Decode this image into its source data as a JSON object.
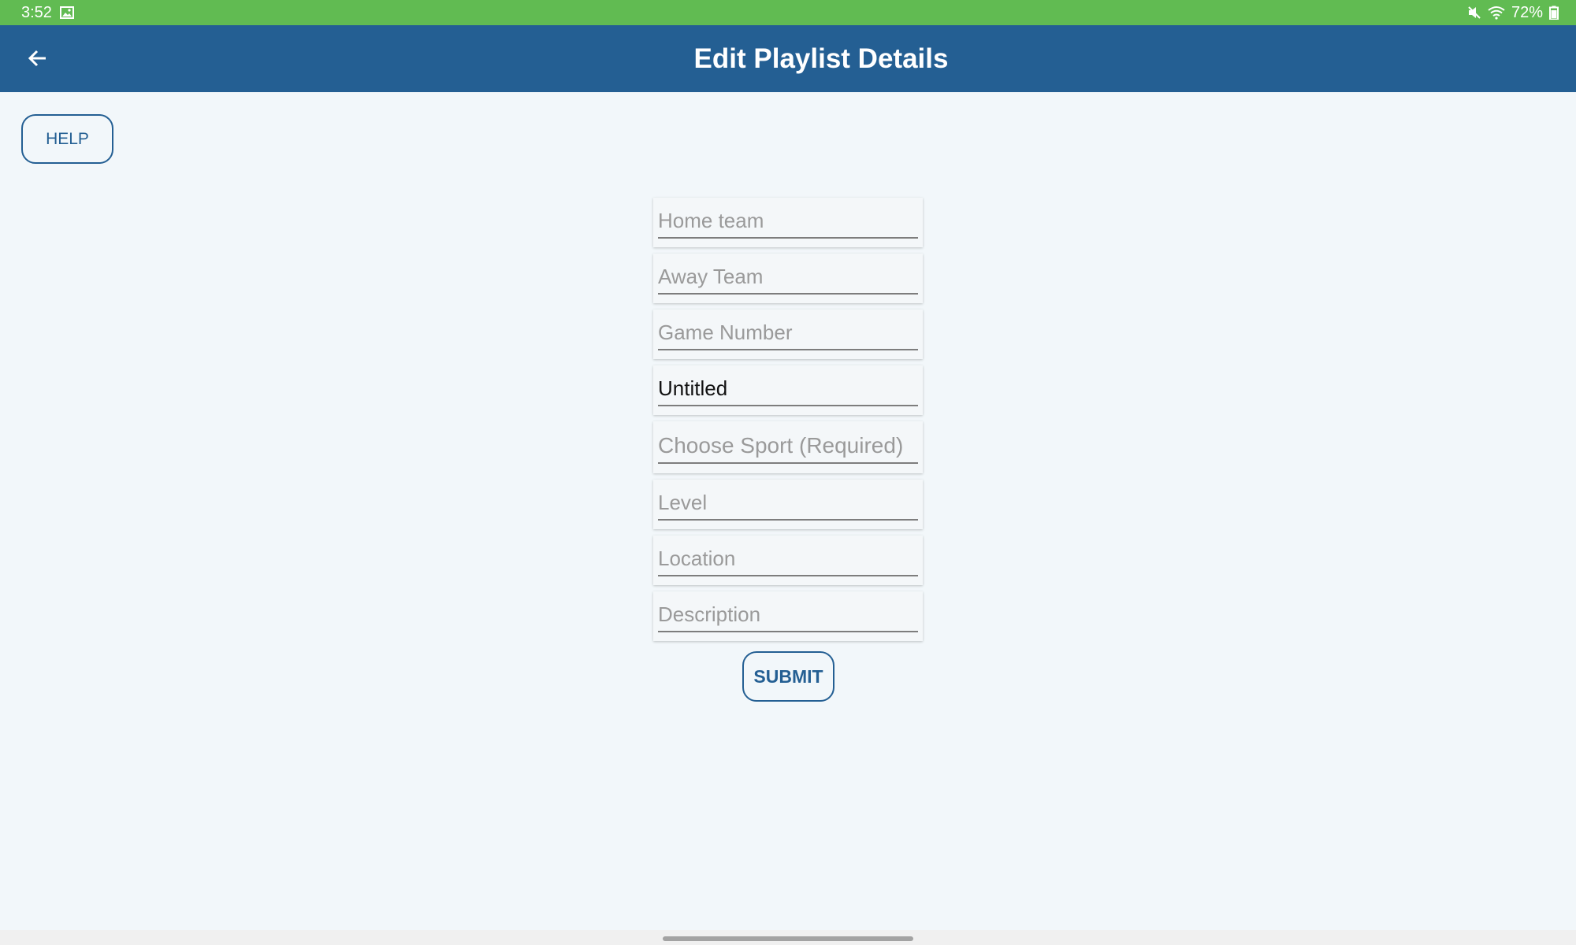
{
  "status_bar": {
    "time": "3:52",
    "battery": "72%",
    "icons": [
      "image-icon",
      "mute-icon",
      "wifi-icon",
      "battery-icon"
    ]
  },
  "app_bar": {
    "title": "Edit Playlist Details",
    "back_icon": "arrow-left-icon"
  },
  "help_button": {
    "label": "HELP"
  },
  "form": {
    "fields": [
      {
        "name": "home-team-input",
        "placeholder": "Home team",
        "value": ""
      },
      {
        "name": "away-team-input",
        "placeholder": "Away Team",
        "value": ""
      },
      {
        "name": "game-number-input",
        "placeholder": "Game Number",
        "value": ""
      },
      {
        "name": "title-input",
        "placeholder": "",
        "value": "Untitled"
      },
      {
        "name": "sport-input",
        "placeholder": "Choose Sport (Required)",
        "value": ""
      },
      {
        "name": "level-input",
        "placeholder": "Level",
        "value": ""
      },
      {
        "name": "location-input",
        "placeholder": "Location",
        "value": ""
      },
      {
        "name": "description-input",
        "placeholder": "Description",
        "value": ""
      }
    ],
    "submit_label": "SUBMIT"
  },
  "colors": {
    "status_bar": "#61bb52",
    "app_bar": "#245f93",
    "accent": "#245f93",
    "background": "#f2f7fa"
  }
}
